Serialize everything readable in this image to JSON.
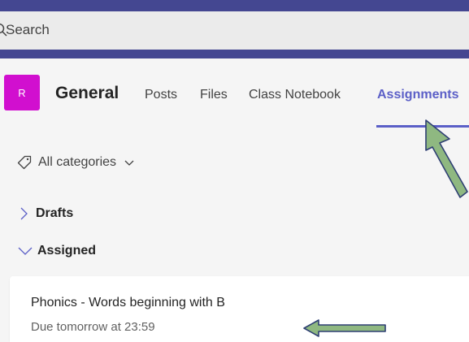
{
  "search": {
    "label": "Search"
  },
  "channel": {
    "avatar_initial": "R",
    "name": "General",
    "tabs": [
      {
        "label": "Posts"
      },
      {
        "label": "Files"
      },
      {
        "label": "Class Notebook"
      },
      {
        "label": "Assignments"
      }
    ],
    "active_tab": "Assignments"
  },
  "filter": {
    "label": "All categories"
  },
  "sections": [
    {
      "label": "Drafts",
      "expanded": false
    },
    {
      "label": "Assigned",
      "expanded": true
    }
  ],
  "assignment": {
    "title": "Phonics - Words beginning with B",
    "due": "Due tomorrow at 23:59"
  },
  "colors": {
    "header": "#444791",
    "accent": "#5b5fc7",
    "avatar": "#d10fcf",
    "annotation_arrow": "#8fb881"
  },
  "icons": {
    "search": "search-icon",
    "tag": "tag-icon",
    "filter_chevron": "chevron-down-icon",
    "drafts_chevron": "chevron-right-icon",
    "assigned_chevron": "chevron-down-icon"
  }
}
